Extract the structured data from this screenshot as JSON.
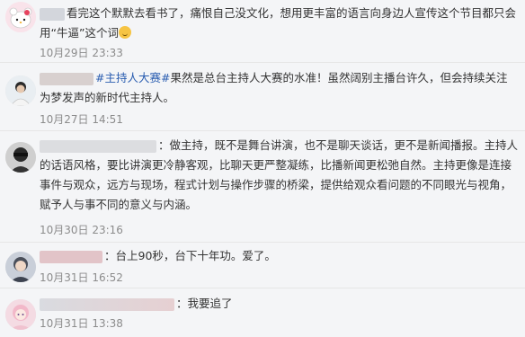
{
  "comments": [
    {
      "text": "看完这个默默去看书了，痛恨自己没文化，想用更丰富的语言向身边人宣传这个节目都只会用“牛逼”这个词",
      "time": "10月29日 23:33",
      "avatar": "hello-kitty-avatar"
    },
    {
      "hashtag": "#主持人大赛#",
      "text": "果然是总台主持人大赛的水准！虽然阔别主播台许久，但会持续关注为梦发声的新时代主持人。",
      "time": "10月27日 14:51",
      "avatar": "person-avatar"
    },
    {
      "text": "：做主持，既不是舞台讲演，也不是聊天谈话，更不是新闻播报。主持人的话语风格，要比讲演更冷静客观，比聊天更严整凝练，比播新闻更松弛自然。主持更像是连接事件与观众，远方与现场，程式计划与操作步骤的桥梁，提供给观众看问题的不同眼光与视角，赋予人与事不同的意义与内涵。",
      "time": "10月30日 23:16",
      "avatar": "sunglasses-avatar"
    },
    {
      "text": "：台上90秒，台下十年功。爱了。",
      "time": "10月31日 16:52",
      "avatar": "anime-avatar"
    },
    {
      "text": "：我要追了",
      "time": "10月31日 13:38",
      "avatar": "pink-anime-avatar"
    }
  ],
  "colors": {
    "link": "#2a5db0",
    "time": "#8c8c8c",
    "background": "#f4f5f7",
    "divider": "#e6e6e6"
  }
}
